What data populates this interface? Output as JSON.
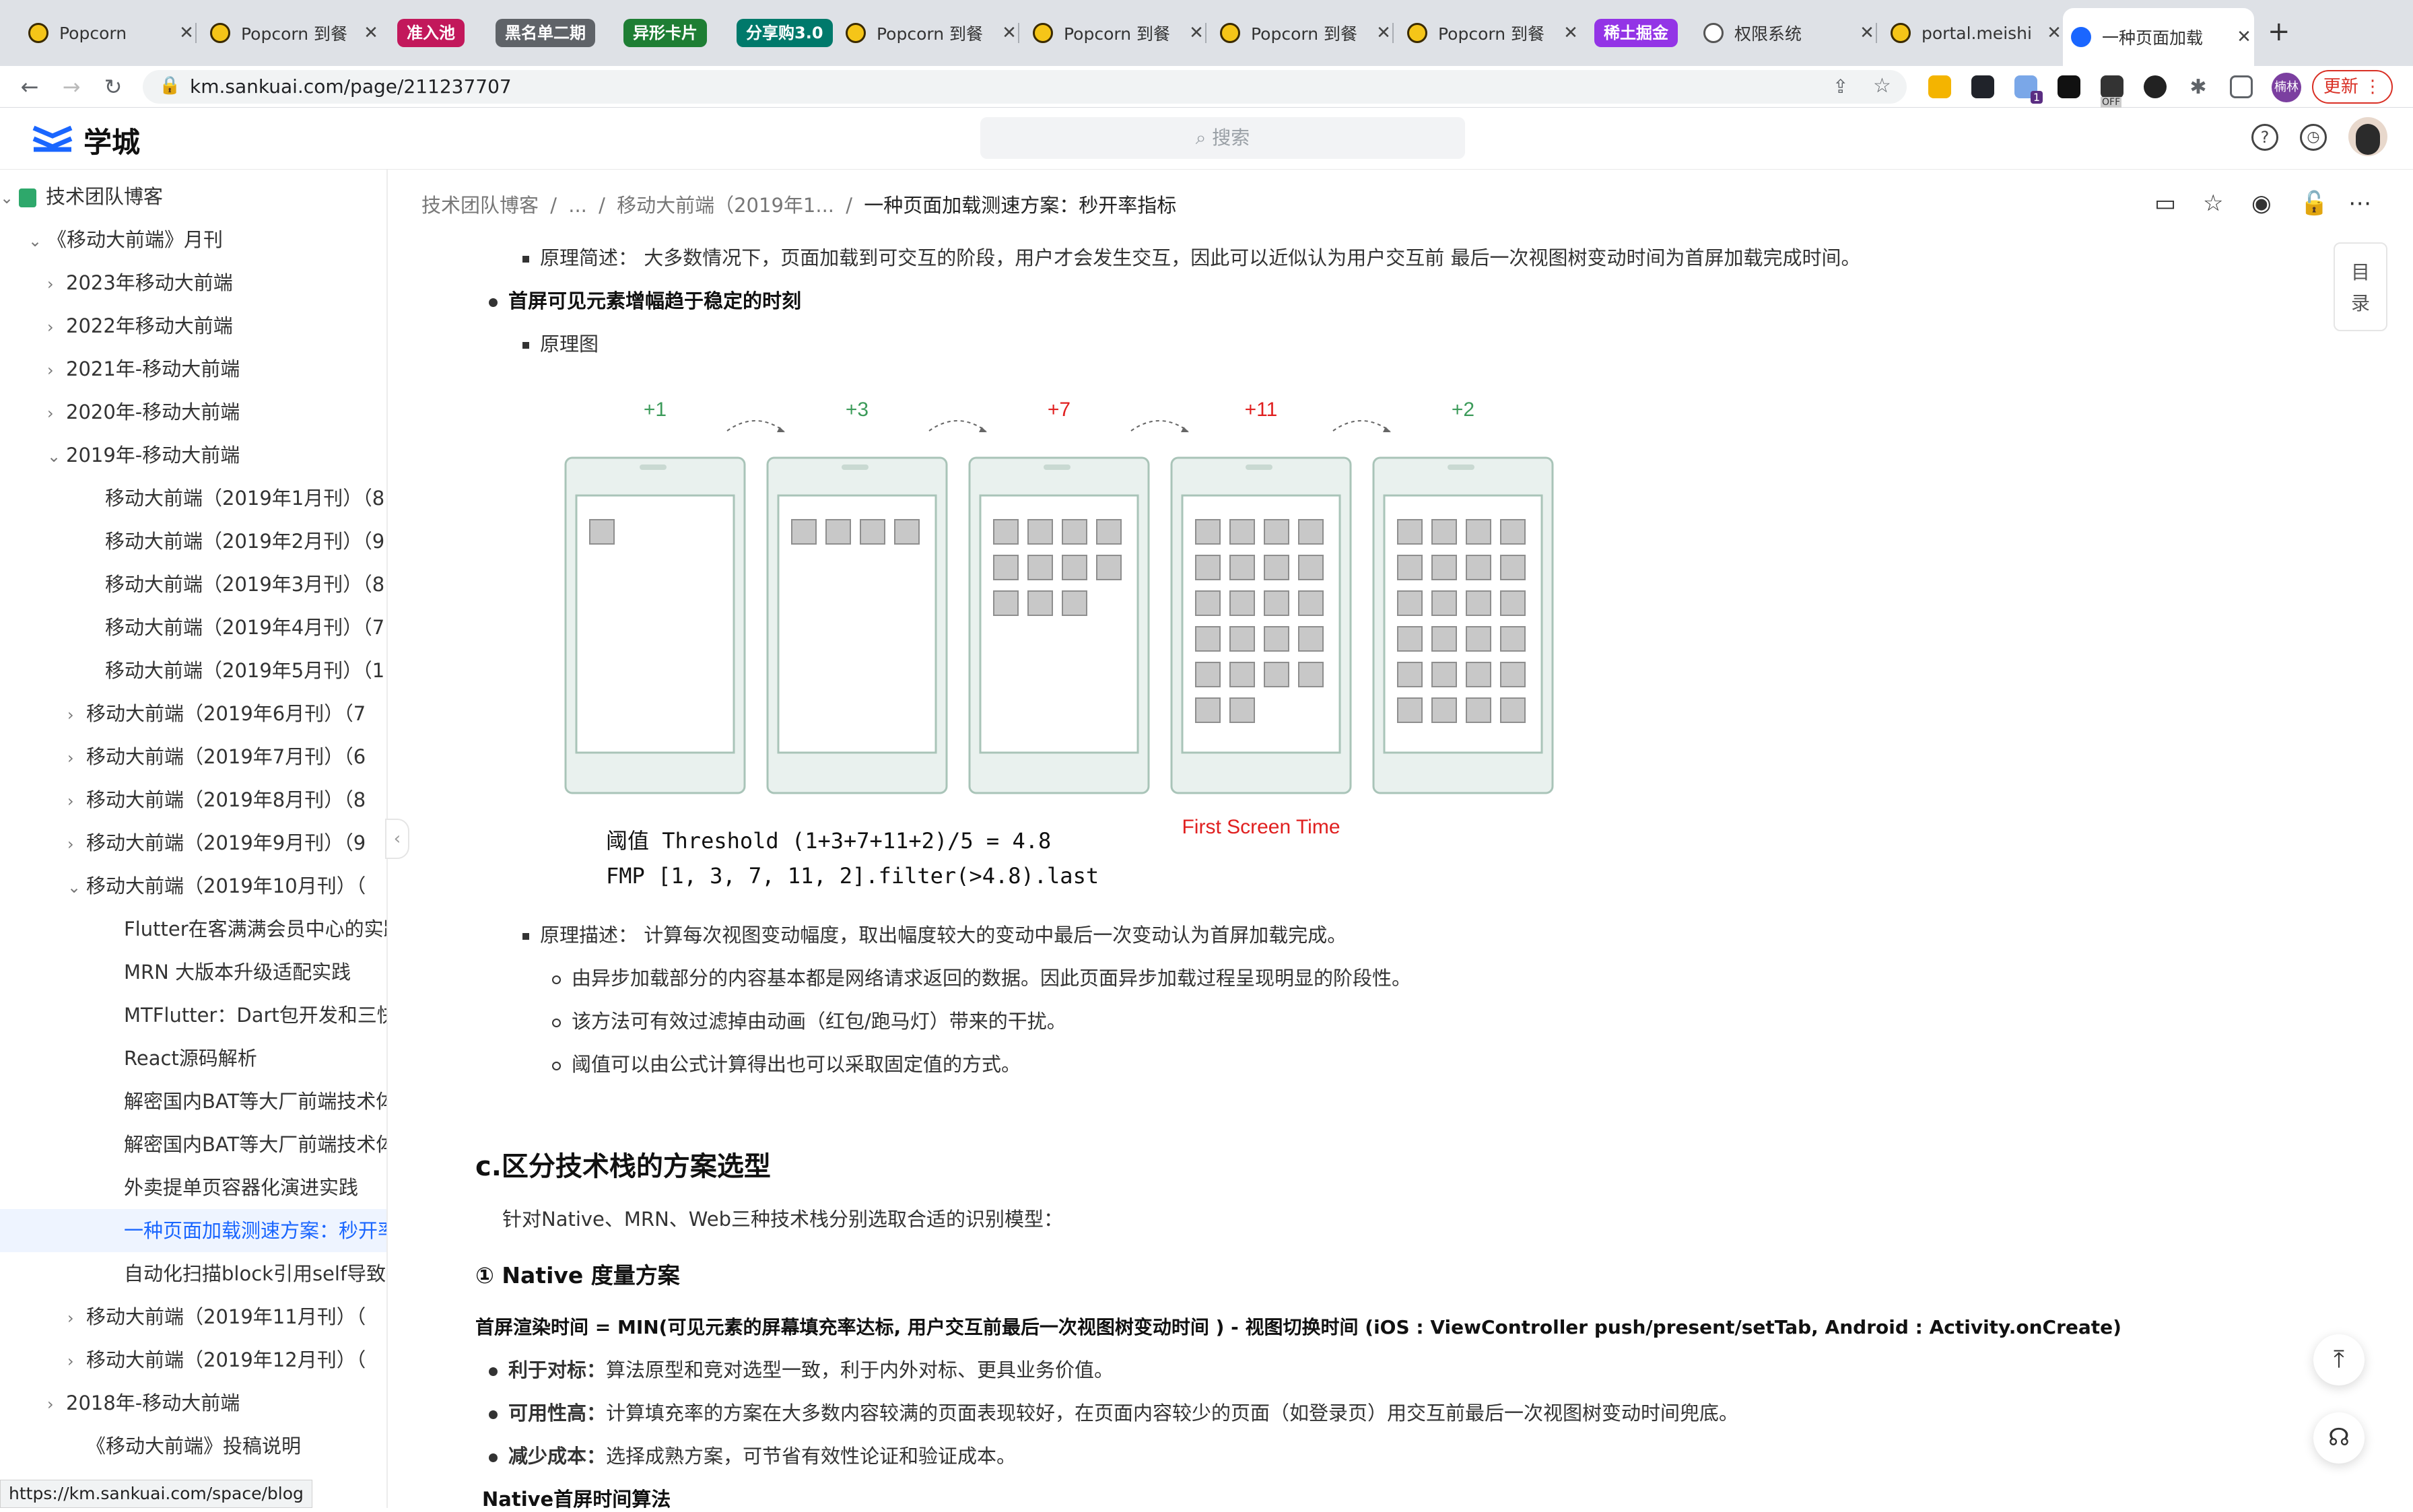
{
  "browser": {
    "tabs": [
      {
        "label": "Popcorn"
      },
      {
        "label": "Popcorn 到餐"
      },
      {
        "label": "Popcorn 到餐"
      },
      {
        "label": "Popcorn 到餐"
      },
      {
        "label": "Popcorn 到餐"
      },
      {
        "label": "Popcorn 到餐"
      },
      {
        "label": "权限系统"
      },
      {
        "label": "portal.meishi"
      },
      {
        "label": "一种页面加载"
      }
    ],
    "groups": [
      {
        "label": "准入池",
        "color": "#c2185b"
      },
      {
        "label": "黑名单二期",
        "color": "#5f6368"
      },
      {
        "label": "异形卡片",
        "color": "#1e7e34"
      },
      {
        "label": "分享购3.0",
        "color": "#00796b"
      },
      {
        "label": "稀土掘金",
        "color": "#9334e6"
      }
    ],
    "new_tab": "+",
    "url": "km.sankuai.com/page/211237707",
    "avatar_text": "楠林",
    "update_label": "更新",
    "ext_badge": "1",
    "ext_off": "OFF"
  },
  "app": {
    "logo": "学城",
    "search_placeholder": "搜索"
  },
  "sidebar": {
    "items": [
      {
        "label": "技术团队博客",
        "arrow": "⌄"
      },
      {
        "label": "《移动大前端》月刊",
        "arrow": "⌄"
      },
      {
        "label": "2023年移动大前端",
        "arrow": "›"
      },
      {
        "label": "2022年移动大前端",
        "arrow": "›"
      },
      {
        "label": "2021年-移动大前端",
        "arrow": "›"
      },
      {
        "label": "2020年-移动大前端",
        "arrow": "›"
      },
      {
        "label": "2019年-移动大前端",
        "arrow": "⌄"
      },
      {
        "label": "移动大前端（2019年1月刊）（8",
        "arrow": ""
      },
      {
        "label": "移动大前端（2019年2月刊）（9",
        "arrow": ""
      },
      {
        "label": "移动大前端（2019年3月刊）（8",
        "arrow": ""
      },
      {
        "label": "移动大前端（2019年4月刊）（7",
        "arrow": ""
      },
      {
        "label": "移动大前端（2019年5月刊）（1",
        "arrow": ""
      },
      {
        "label": "移动大前端（2019年6月刊）（7",
        "arrow": "›"
      },
      {
        "label": "移动大前端（2019年7月刊）（6",
        "arrow": "›"
      },
      {
        "label": "移动大前端（2019年8月刊）（8",
        "arrow": "›"
      },
      {
        "label": "移动大前端（2019年9月刊）（9",
        "arrow": "›"
      },
      {
        "label": "移动大前端（2019年10月刊）（",
        "arrow": "⌄"
      },
      {
        "label": "Flutter在客满满会员中心的实践",
        "arrow": ""
      },
      {
        "label": "MRN 大版本升级适配实践",
        "arrow": ""
      },
      {
        "label": "MTFlutter：Dart包开发和三快F",
        "arrow": ""
      },
      {
        "label": "React源码解析",
        "arrow": ""
      },
      {
        "label": "解密国内BAT等大厂前端技术体",
        "arrow": ""
      },
      {
        "label": "解密国内BAT等大厂前端技术体",
        "arrow": ""
      },
      {
        "label": "外卖提单页容器化演进实践",
        "arrow": ""
      },
      {
        "label": "一种页面加载测速方案：秒开率",
        "arrow": ""
      },
      {
        "label": "自动化扫描block引用self导致的",
        "arrow": ""
      },
      {
        "label": "移动大前端（2019年11月刊）（",
        "arrow": "›"
      },
      {
        "label": "移动大前端（2019年12月刊）（",
        "arrow": "›"
      },
      {
        "label": "2018年-移动大前端",
        "arrow": "›"
      },
      {
        "label": "《移动大前端》投稿说明",
        "arrow": ""
      }
    ],
    "collapse_glyph": "‹",
    "status_url": "https://km.sankuai.com/space/blog"
  },
  "breadcrumb": [
    "技术团队博客",
    "...",
    "移动大前端（2019年1...",
    "一种页面加载测速方案：秒开率指标"
  ],
  "breadcrumb_sep": "/",
  "toc_label_1": "目",
  "toc_label_2": "录",
  "content": {
    "line1": "原理简述：  大多数情况下，页面加载到可交互的阶段，用户才会发生交互，因此可以近似认为用户交互前 最后一次视图树变动时间为首屏加载完成时间。",
    "bullet_title": "首屏可见元素增幅趋于稳定的时刻",
    "diagram_label": "原理图",
    "diagram": {
      "increments": [
        "+1",
        "+3",
        "+7",
        "+11",
        "+2"
      ],
      "increment_colors": [
        "#3c9b5a",
        "#3c9b5a",
        "#e02020",
        "#e02020",
        "#3c9b5a"
      ],
      "cumulative_blocks": [
        1,
        4,
        11,
        22,
        24
      ],
      "first_screen_label": "First Screen Time",
      "formula_1": "阈值 Threshold (1+3+7+11+2)/5 = 4.8",
      "formula_2": "FMP [1, 3, 7, 11, 2].filter(>4.8).last"
    },
    "desc": "原理描述：  计算每次视图变动幅度，取出幅度较大的变动中最后一次变动认为首屏加载完成。",
    "sub1": "由异步加载部分的内容基本都是网络请求返回的数据。因此页面异步加载过程呈现明显的阶段性。",
    "sub2": "该方法可有效过滤掉由动画（红包/跑马灯）带来的干扰。",
    "sub3": "阈值可以由公式计算得出也可以采取固定值的方式。",
    "section_c": "c.区分技术栈的方案选型",
    "section_c_desc": "针对Native、MRN、Web三种技术栈分别选取合适的识别模型：",
    "native_title": "① Native 度量方案",
    "native_formula": "首屏渲染时间 = MIN(可见元素的屏幕填充率达标, 用户交互前最后一次视图树变动时间 ) - 视图切换时间 (iOS : ViewController push/present/setTab, Android : Activity.onCreate)",
    "pros": [
      {
        "title": "利于对标：",
        "text": "算法原型和竞对选型一致，利于内外对标、更具业务价值。"
      },
      {
        "title": "可用性高：",
        "text": "计算填充率的方案在大多数内容较满的页面表现较好，在页面内容较少的页面（如登录页）用交互前最后一次视图树变动时间兜底。"
      },
      {
        "title": "减少成本：",
        "text": "选择成熟方案，可节省有效性论证和验证成本。"
      }
    ],
    "native_algo_title": "Native首屏时间算法"
  },
  "fab": {
    "top": "⤒",
    "support": "☊"
  }
}
